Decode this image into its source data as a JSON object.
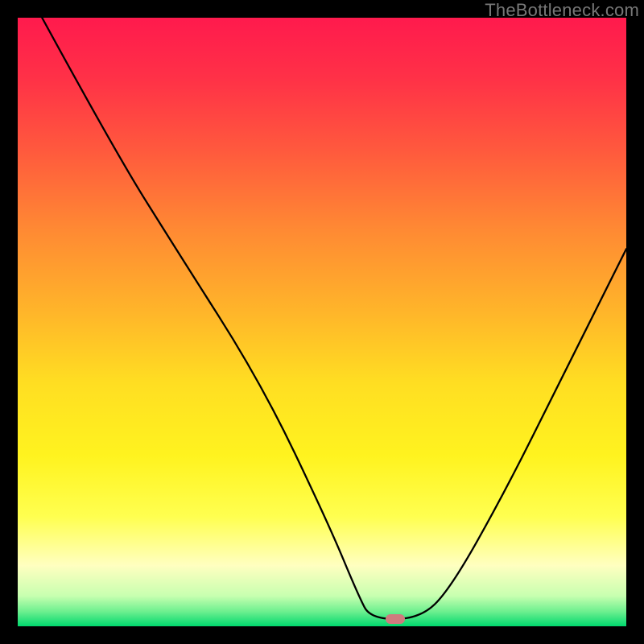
{
  "watermark": "TheBottleneck.com",
  "colors": {
    "frame": "#000000",
    "marker": "#cf7b7e",
    "gradient_stops": [
      {
        "offset": 0.0,
        "color": "#ff1a4d"
      },
      {
        "offset": 0.1,
        "color": "#ff3147"
      },
      {
        "offset": 0.22,
        "color": "#ff5a3d"
      },
      {
        "offset": 0.35,
        "color": "#ff8a33"
      },
      {
        "offset": 0.48,
        "color": "#ffb42a"
      },
      {
        "offset": 0.6,
        "color": "#ffde22"
      },
      {
        "offset": 0.72,
        "color": "#fff31f"
      },
      {
        "offset": 0.82,
        "color": "#ffff50"
      },
      {
        "offset": 0.9,
        "color": "#ffffc0"
      },
      {
        "offset": 0.95,
        "color": "#c8ffb0"
      },
      {
        "offset": 0.975,
        "color": "#70f090"
      },
      {
        "offset": 1.0,
        "color": "#00d86e"
      }
    ]
  },
  "chart_data": {
    "type": "line",
    "title": "",
    "xlabel": "",
    "ylabel": "",
    "xlim": [
      0,
      100
    ],
    "ylim": [
      0,
      100
    ],
    "marker": {
      "x": 62,
      "y": 1.2
    },
    "series": [
      {
        "name": "bottleneck-curve",
        "points": [
          {
            "x": 4,
            "y": 100
          },
          {
            "x": 16,
            "y": 78
          },
          {
            "x": 26,
            "y": 62
          },
          {
            "x": 40,
            "y": 40
          },
          {
            "x": 51,
            "y": 17
          },
          {
            "x": 56,
            "y": 5
          },
          {
            "x": 58,
            "y": 1.2
          },
          {
            "x": 66,
            "y": 1.2
          },
          {
            "x": 71,
            "y": 6
          },
          {
            "x": 80,
            "y": 22
          },
          {
            "x": 89,
            "y": 40
          },
          {
            "x": 96,
            "y": 54
          },
          {
            "x": 100,
            "y": 62
          }
        ]
      }
    ]
  }
}
